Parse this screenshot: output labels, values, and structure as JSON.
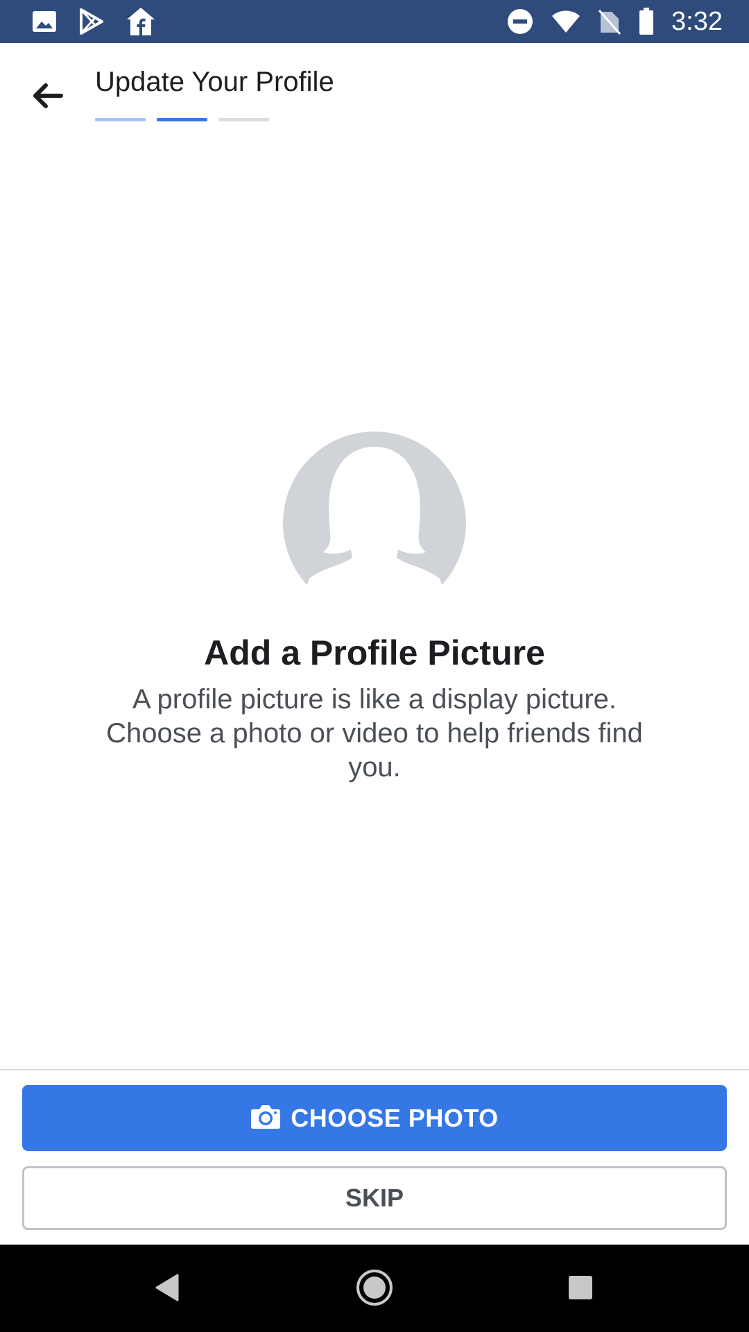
{
  "status_bar": {
    "time": "3:32",
    "left_icons": [
      "gallery-icon",
      "play-store-icon",
      "facebook-home-icon"
    ],
    "right_icons": [
      "do-not-disturb-icon",
      "wifi-icon",
      "no-sim-icon",
      "battery-icon"
    ],
    "background": "#2f4b7c"
  },
  "header": {
    "title": "Update Your Profile",
    "back_icon": "back-arrow-icon",
    "progress": {
      "total_steps": 3,
      "current_step": 2,
      "colors": [
        "#a7c4f2",
        "#3578e5",
        "#dadde1"
      ]
    }
  },
  "main": {
    "avatar_icon": "profile-silhouette-icon",
    "title": "Add a Profile Picture",
    "description": "A profile picture is like a display picture. Choose a photo or video to help friends find you."
  },
  "actions": {
    "choose_photo": {
      "label": "CHOOSE PHOTO",
      "icon": "camera-icon",
      "color": "#3578e5"
    },
    "skip": {
      "label": "SKIP"
    }
  },
  "nav_bar": {
    "buttons": [
      "back-triangle-icon",
      "home-circle-icon",
      "recents-square-icon"
    ]
  }
}
